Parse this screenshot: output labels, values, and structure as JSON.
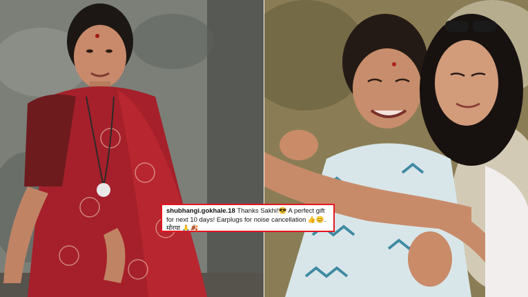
{
  "comment": {
    "username": "shubhangi.gokhale.18",
    "text": "Thanks Sakhi!😎 A perfect gift for next 10 days! Earplugs for noise cancellation 👍😊. मोरया 🙏🍂"
  },
  "colors": {
    "highlight_border": "#e5141f",
    "saree_red": "#a5202a",
    "kurta_blue": "#6aa7b8",
    "background_wall": "#6f736d",
    "background_foliage": "#7d7048"
  },
  "photos": [
    {
      "name": "left-photo",
      "subject": "woman in red saree seated against weathered wall"
    },
    {
      "name": "right-photo",
      "subject": "two women embracing outdoors"
    }
  ]
}
